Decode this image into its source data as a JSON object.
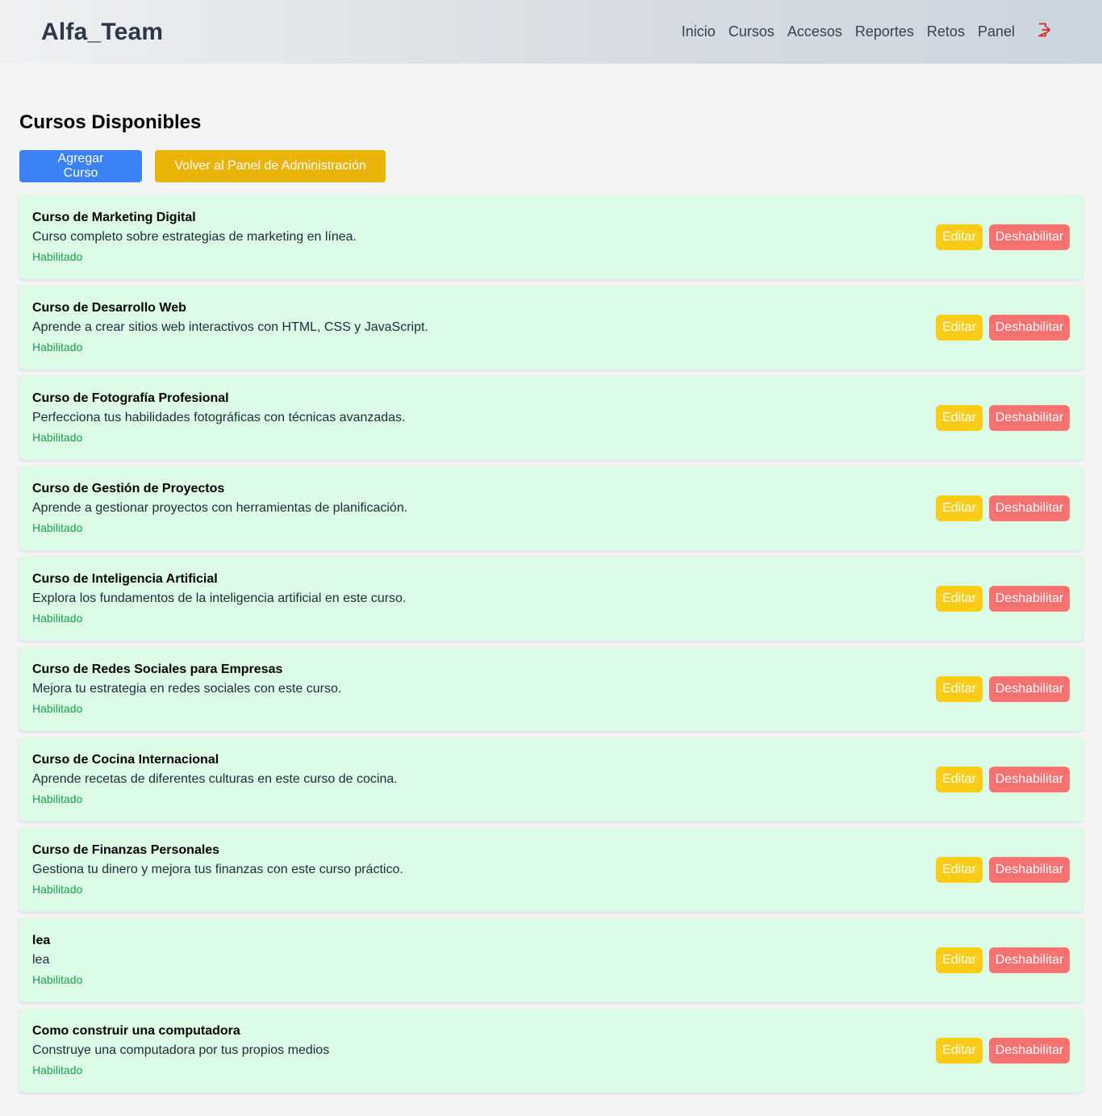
{
  "brand": "Alfa_Team",
  "nav": {
    "items": [
      "Inicio",
      "Cursos",
      "Accesos",
      "Reportes",
      "Retos",
      "Panel"
    ],
    "logout_icon": "logout-icon",
    "logout_color": "#dc2626"
  },
  "page": {
    "title": "Cursos Disponibles",
    "add_label": "Agregar Curso",
    "back_label": "Volver al Panel de Administración"
  },
  "colors": {
    "primary": "#3b82f6",
    "warning": "#eab308",
    "edit": "#facc15",
    "danger": "#f87171",
    "card_bg": "#dcfce7",
    "status_ok": "#16a34a"
  },
  "courses": [
    {
      "title": "Curso de Marketing Digital",
      "description": "Curso completo sobre estrategias de marketing en línea.",
      "status": "Habilitado",
      "edit_label": "Editar",
      "disable_label": "Deshabilitar"
    },
    {
      "title": "Curso de Desarrollo Web",
      "description": "Aprende a crear sitios web interactivos con HTML, CSS y JavaScript.",
      "status": "Habilitado",
      "edit_label": "Editar",
      "disable_label": "Deshabilitar"
    },
    {
      "title": "Curso de Fotografía Profesional",
      "description": "Perfecciona tus habilidades fotográficas con técnicas avanzadas.",
      "status": "Habilitado",
      "edit_label": "Editar",
      "disable_label": "Deshabilitar"
    },
    {
      "title": "Curso de Gestión de Proyectos",
      "description": "Aprende a gestionar proyectos con herramientas de planificación.",
      "status": "Habilitado",
      "edit_label": "Editar",
      "disable_label": "Deshabilitar"
    },
    {
      "title": "Curso de Inteligencia Artificial",
      "description": "Explora los fundamentos de la inteligencia artificial en este curso.",
      "status": "Habilitado",
      "edit_label": "Editar",
      "disable_label": "Deshabilitar"
    },
    {
      "title": "Curso de Redes Sociales para Empresas",
      "description": "Mejora tu estrategia en redes sociales con este curso.",
      "status": "Habilitado",
      "edit_label": "Editar",
      "disable_label": "Deshabilitar"
    },
    {
      "title": "Curso de Cocina Internacional",
      "description": "Aprende recetas de diferentes culturas en este curso de cocina.",
      "status": "Habilitado",
      "edit_label": "Editar",
      "disable_label": "Deshabilitar"
    },
    {
      "title": "Curso de Finanzas Personales",
      "description": "Gestiona tu dinero y mejora tus finanzas con este curso práctico.",
      "status": "Habilitado",
      "edit_label": "Editar",
      "disable_label": "Deshabilitar"
    },
    {
      "title": "lea",
      "description": "lea",
      "status": "Habilitado",
      "edit_label": "Editar",
      "disable_label": "Deshabilitar"
    },
    {
      "title": "Como construir una computadora",
      "description": "Construye una computadora por tus propios medios",
      "status": "Habilitado",
      "edit_label": "Editar",
      "disable_label": "Deshabilitar"
    }
  ]
}
